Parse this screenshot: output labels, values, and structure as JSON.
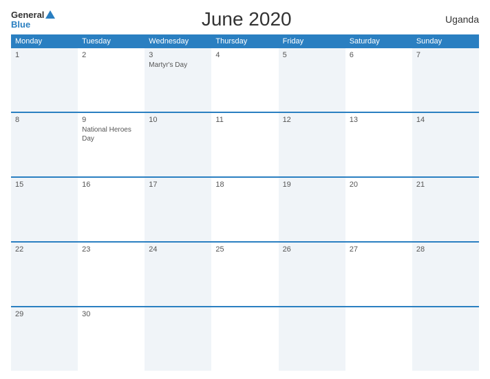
{
  "header": {
    "logo_general": "General",
    "logo_blue": "Blue",
    "title": "June 2020",
    "country": "Uganda"
  },
  "calendar": {
    "day_headers": [
      "Monday",
      "Tuesday",
      "Wednesday",
      "Thursday",
      "Friday",
      "Saturday",
      "Sunday"
    ],
    "weeks": [
      [
        {
          "num": "1",
          "event": ""
        },
        {
          "num": "2",
          "event": ""
        },
        {
          "num": "3",
          "event": "Martyr's Day"
        },
        {
          "num": "4",
          "event": ""
        },
        {
          "num": "5",
          "event": ""
        },
        {
          "num": "6",
          "event": ""
        },
        {
          "num": "7",
          "event": ""
        }
      ],
      [
        {
          "num": "8",
          "event": ""
        },
        {
          "num": "9",
          "event": "National Heroes Day"
        },
        {
          "num": "10",
          "event": ""
        },
        {
          "num": "11",
          "event": ""
        },
        {
          "num": "12",
          "event": ""
        },
        {
          "num": "13",
          "event": ""
        },
        {
          "num": "14",
          "event": ""
        }
      ],
      [
        {
          "num": "15",
          "event": ""
        },
        {
          "num": "16",
          "event": ""
        },
        {
          "num": "17",
          "event": ""
        },
        {
          "num": "18",
          "event": ""
        },
        {
          "num": "19",
          "event": ""
        },
        {
          "num": "20",
          "event": ""
        },
        {
          "num": "21",
          "event": ""
        }
      ],
      [
        {
          "num": "22",
          "event": ""
        },
        {
          "num": "23",
          "event": ""
        },
        {
          "num": "24",
          "event": ""
        },
        {
          "num": "25",
          "event": ""
        },
        {
          "num": "26",
          "event": ""
        },
        {
          "num": "27",
          "event": ""
        },
        {
          "num": "28",
          "event": ""
        }
      ],
      [
        {
          "num": "29",
          "event": ""
        },
        {
          "num": "30",
          "event": ""
        },
        {
          "num": "",
          "event": ""
        },
        {
          "num": "",
          "event": ""
        },
        {
          "num": "",
          "event": ""
        },
        {
          "num": "",
          "event": ""
        },
        {
          "num": "",
          "event": ""
        }
      ]
    ]
  }
}
